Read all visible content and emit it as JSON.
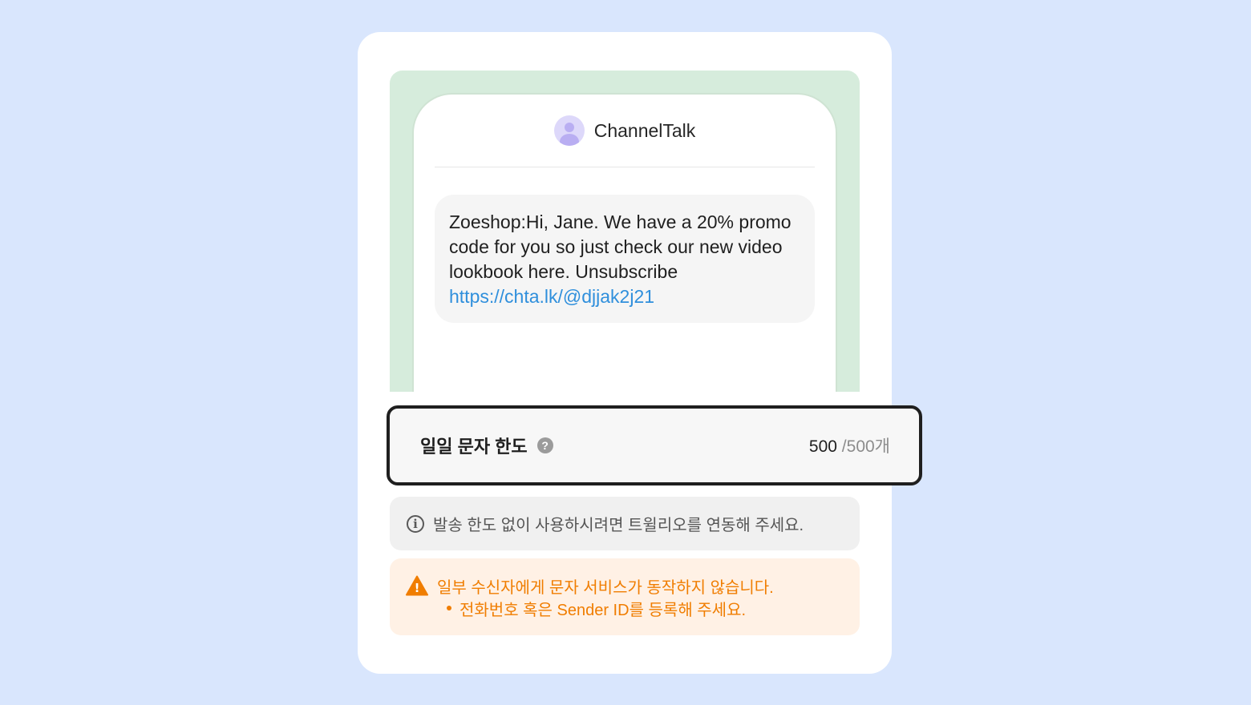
{
  "preview": {
    "sender_name": "ChannelTalk",
    "message_text": "Zoeshop:Hi, Jane. We have a 20% promo code for you so just check our new video lookbook here. Unsubscribe ",
    "message_link": "https://chta.lk/@djjak2j21"
  },
  "limit": {
    "title": "일일 문자 한도",
    "help_glyph": "?",
    "count": "500",
    "max": " /500개"
  },
  "info": {
    "glyph": "i",
    "text": "발송 한도 없이 사용하시려면 트윌리오를 연동해 주세요."
  },
  "warning": {
    "text": "일부 수신자에게 문자 서비스가 동작하지 않습니다.",
    "bullet": "전화번호 혹은 Sender ID를 등록해 주세요.",
    "glyph": "!"
  },
  "colors": {
    "background": "#d9e6fd",
    "preview_bg": "#d6ecdc",
    "link": "#2f8fdc",
    "warning": "#f07d00"
  }
}
